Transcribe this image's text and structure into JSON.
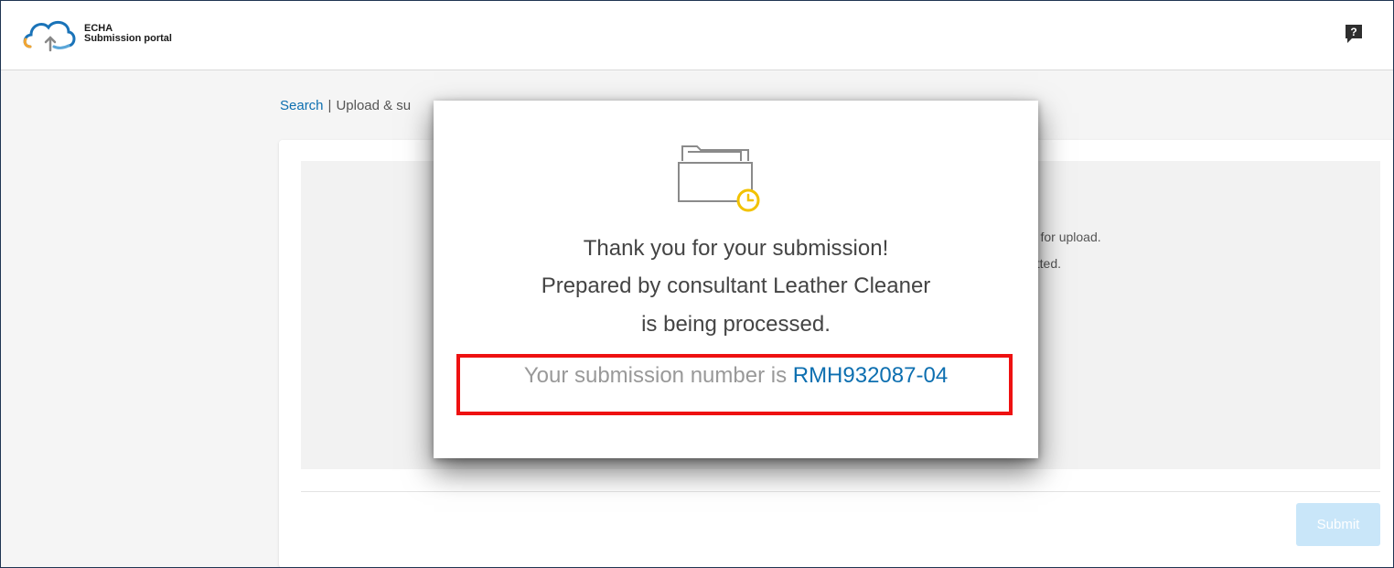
{
  "header": {
    "logo_line1": "ECHA",
    "logo_line2": "Submission portal",
    "help_icon": "question-bubble-icon"
  },
  "breadcrumb": {
    "search": "Search",
    "separator": "|",
    "current_partial": "Upload & su"
  },
  "background": {
    "line1_partial": "ed for upload.",
    "line2_partial": "mitted.",
    "submit_label": "Submit"
  },
  "modal": {
    "icon": "folder-clock-icon",
    "line1": "Thank you for your submission!",
    "line2": "Prepared by consultant Leather Cleaner",
    "line3": "is being processed.",
    "number_prefix": "Your submission number is",
    "number": "RMH932087-04"
  },
  "colors": {
    "accent": "#0d6fb0",
    "highlight": "#ee1111",
    "clock_yellow": "#f2c200"
  }
}
